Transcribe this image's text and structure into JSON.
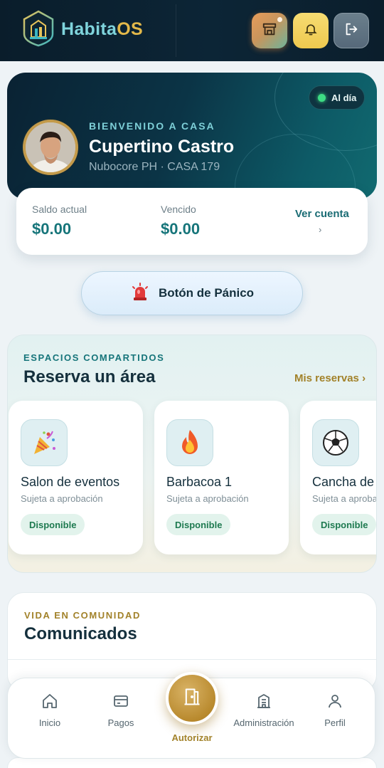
{
  "header": {
    "brand_part1": "Habita",
    "brand_part2": "OS",
    "store_icon": "store-icon",
    "bell_icon": "bell-icon",
    "logout_icon": "logout-icon"
  },
  "hero": {
    "status": "Al día",
    "welcome": "BIENVENIDO A CASA",
    "name": "Cupertino Castro",
    "unit": "Nubocore PH · CASA 179"
  },
  "balance": {
    "current_label": "Saldo actual",
    "current_value": "$0.00",
    "overdue_label": "Vencido",
    "overdue_value": "$0.00",
    "link": "Ver cuenta",
    "link_chevron": "›"
  },
  "panic": {
    "label": "Botón de Pánico",
    "icon": "siren-icon"
  },
  "spaces": {
    "eyebrow": "ESPACIOS COMPARTIDOS",
    "title": "Reserva un área",
    "my_reservations": "Mis reservas ›",
    "cards": [
      {
        "title": "Salon de eventos",
        "subtitle": "Sujeta a aprobación",
        "status": "Disponible",
        "icon": "party-popper-icon"
      },
      {
        "title": "Barbacoa 1",
        "subtitle": "Sujeta a aprobación",
        "status": "Disponible",
        "icon": "fire-icon"
      },
      {
        "title": "Cancha de f",
        "subtitle": "Sujeta a aprobación",
        "status": "Disponible",
        "icon": "soccer-ball-icon"
      }
    ]
  },
  "community": {
    "eyebrow": "VIDA EN COMUNIDAD",
    "title": "Comunicados"
  },
  "nav": {
    "items": [
      {
        "label": "Inicio",
        "icon": "home-icon"
      },
      {
        "label": "Pagos",
        "icon": "card-icon"
      },
      {
        "label": "Autorizar",
        "icon": "door-icon"
      },
      {
        "label": "Administración",
        "icon": "building-icon"
      },
      {
        "label": "Perfil",
        "icon": "user-icon"
      }
    ]
  },
  "colors": {
    "accent_teal": "#16757a",
    "accent_gold": "#a2822a",
    "status_green": "#3ddc84",
    "dark_header": "#0b1e2c"
  }
}
